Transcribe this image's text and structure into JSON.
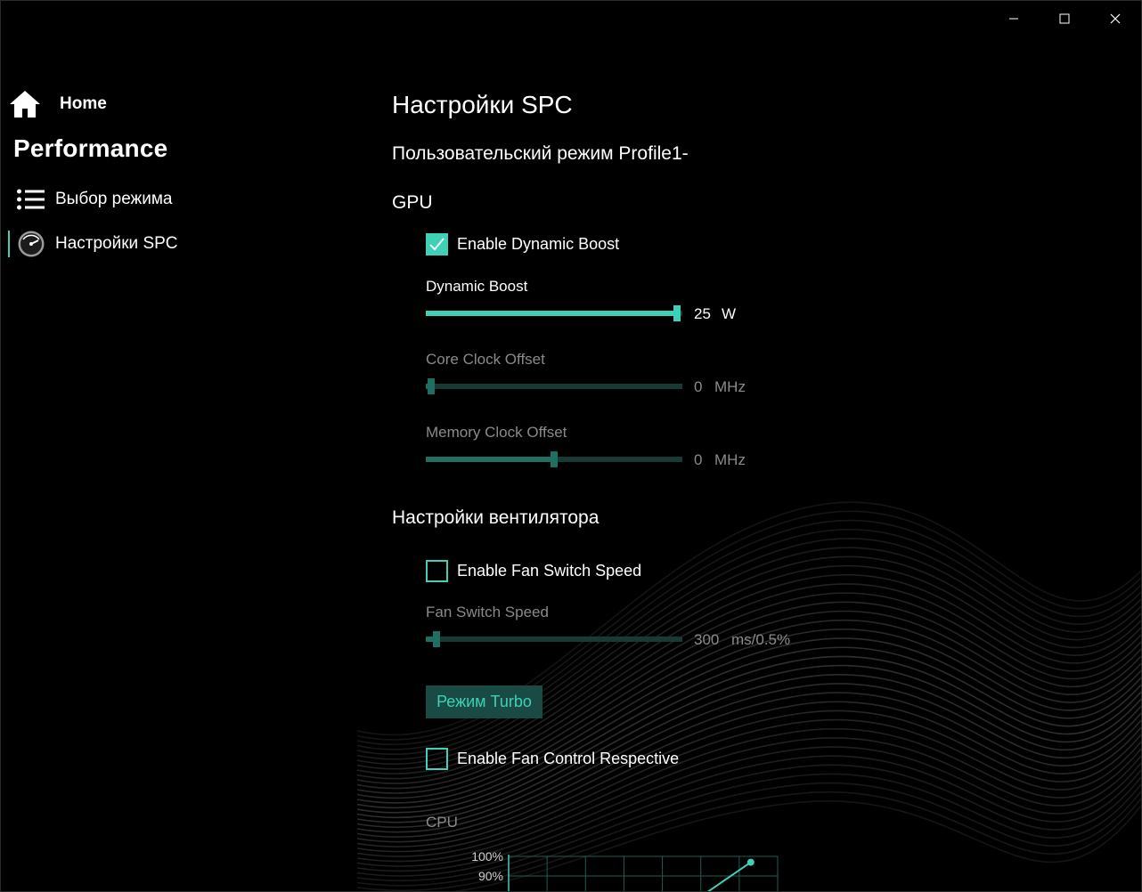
{
  "sidebar": {
    "home_label": "Home",
    "title": "Performance",
    "items": [
      {
        "label": "Выбор режима",
        "icon": "list-icon"
      },
      {
        "label": "Настройки SPC",
        "icon": "gauge-icon",
        "selected": true
      }
    ]
  },
  "main": {
    "title": "Настройки SPC",
    "profile_line": "Пользовательский режим Profile1-",
    "gpu": {
      "title": "GPU",
      "dynamic_boost_checkbox": {
        "label": "Enable Dynamic Boost",
        "checked": true
      },
      "sliders": [
        {
          "label": "Dynamic Boost",
          "value": "25",
          "unit": "W",
          "fraction": 1.0,
          "enabled": true
        },
        {
          "label": "Core Clock Offset",
          "value": "0",
          "unit": "MHz",
          "fraction": 0.0,
          "enabled": false
        },
        {
          "label": "Memory Clock Offset",
          "value": "0",
          "unit": "MHz",
          "fraction": 0.5,
          "enabled": false
        }
      ]
    },
    "fan": {
      "title": "Настройки вентилятора",
      "switch_speed_checkbox": {
        "label": "Enable Fan Switch Speed",
        "checked": false
      },
      "switch_speed_slider": {
        "label": "Fan Switch Speed",
        "value": "300",
        "unit": "ms/0.5%",
        "fraction": 0.02,
        "enabled": false
      },
      "turbo_button": "Режим Turbo",
      "respective_checkbox": {
        "label": "Enable Fan Control Respective",
        "checked": false
      },
      "cpu_label": "CPU"
    }
  },
  "chart_data": {
    "type": "line",
    "title": "CPU",
    "y_ticks": [
      "100%",
      "90%"
    ],
    "ylim_visible": [
      80,
      100
    ],
    "series": [
      {
        "x": [
          0.72,
          0.9
        ],
        "y": [
          80,
          97
        ]
      }
    ]
  },
  "colors": {
    "accent": "#3ed1b8",
    "accent_dim": "#1f6e62",
    "background": "#000000"
  }
}
